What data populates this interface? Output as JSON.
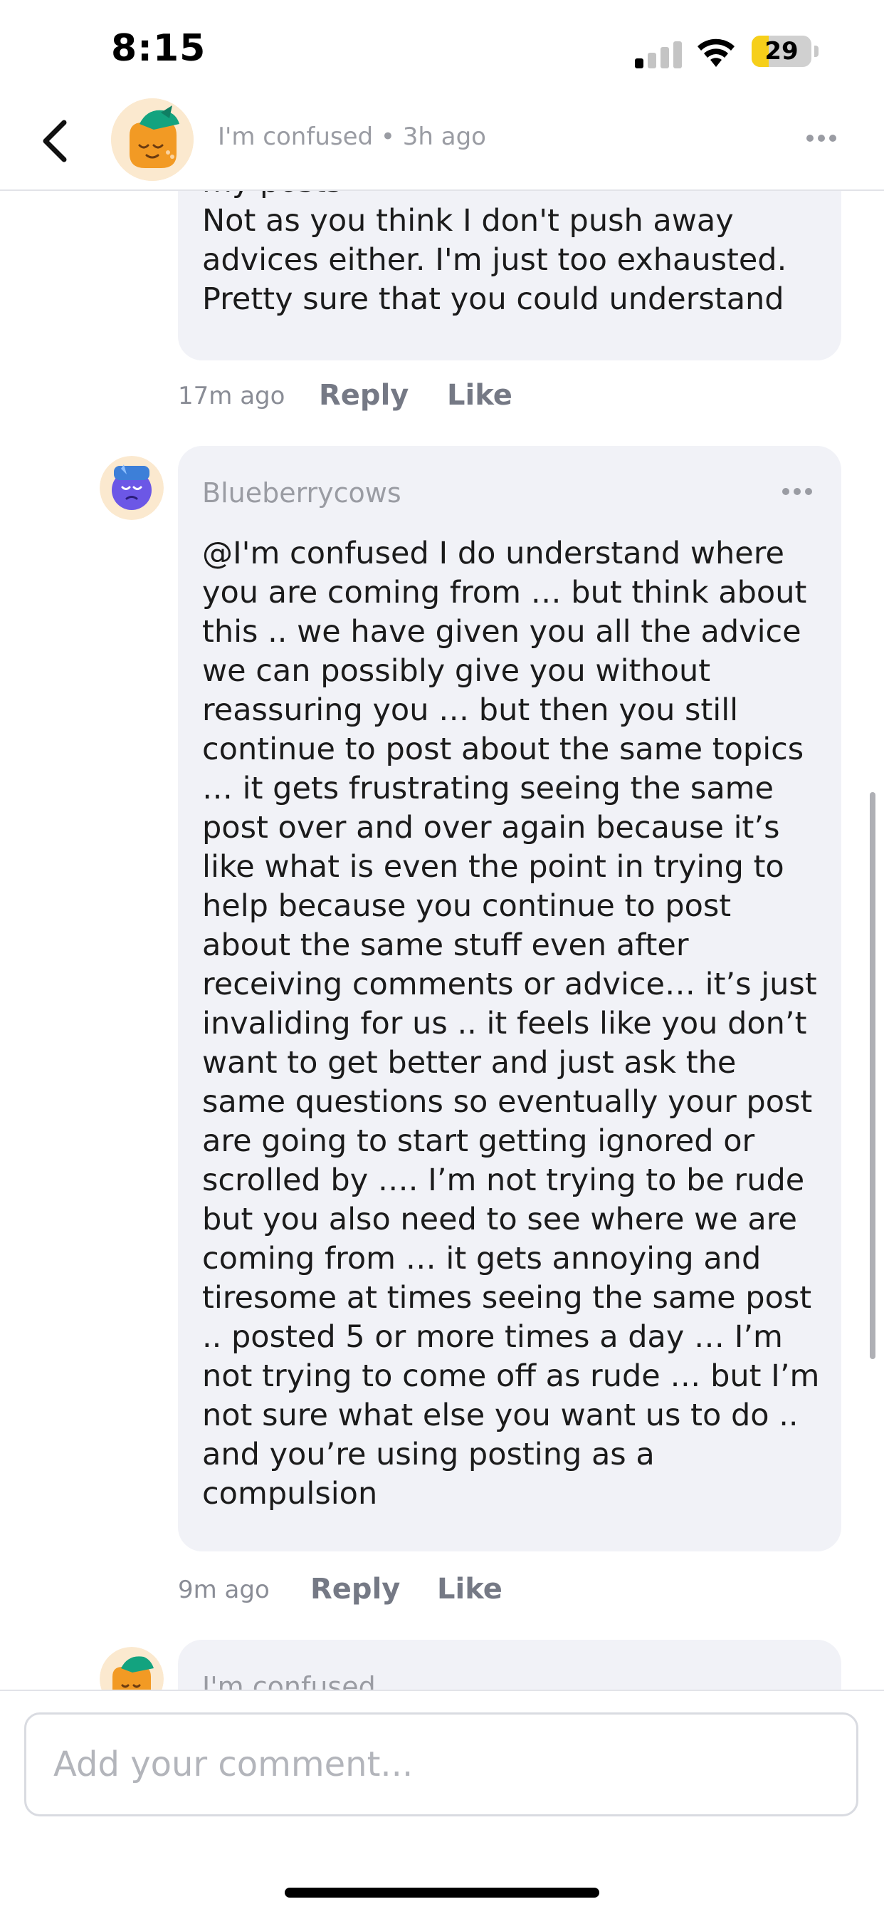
{
  "status_bar": {
    "time": "8:15",
    "battery_level": "29",
    "signal_bars_active": 1,
    "signal_bars_total": 4
  },
  "header": {
    "author": "I'm confused",
    "separator": "•",
    "time_ago": "3h ago",
    "back_icon": "chevron-left-icon",
    "more_icon": "ellipsis-icon"
  },
  "comments": [
    {
      "partial_text": "my posts\nNot as you think I don't push away advices either. I'm just too exhausted. Pretty sure that you could understand",
      "time_ago": "17m ago",
      "reply_label": "Reply",
      "like_label": "Like"
    },
    {
      "username": "Blueberrycows",
      "text": "@I'm confused I do understand where you are coming from … but think about this .. we have given you all the advice we can possibly give you without reassuring you … but then you still continue to post about the same topics … it gets frustrating seeing the same post over and over again because it’s like what is even the point in trying to help because you continue to post about the same stuff even after receiving comments or advice… it’s just invaliding for us .. it feels like you don’t want to get better and just ask the same questions so eventually your post are going to start getting ignored or scrolled by …. I’m not trying to be rude but you also need to see where we are coming from … it gets annoying and tiresome at times seeing the same post .. posted 5 or more times a day … I’m not trying to come off as rude … but I’m not sure what else you want us to do .. and you’re using posting as a compulsion",
      "time_ago": "9m ago",
      "reply_label": "Reply",
      "like_label": "Like"
    },
    {
      "username": "I'm confused"
    }
  ],
  "composer": {
    "placeholder": "Add your comment..."
  },
  "colors": {
    "bubble_bg": "#f1f2f7",
    "meta_gray": "#9a9ca3",
    "action_gray": "#757985",
    "orange_avatar": "#f29a24",
    "purple_avatar": "#6c57e6",
    "battery_yellow": "#f6cf1a"
  }
}
